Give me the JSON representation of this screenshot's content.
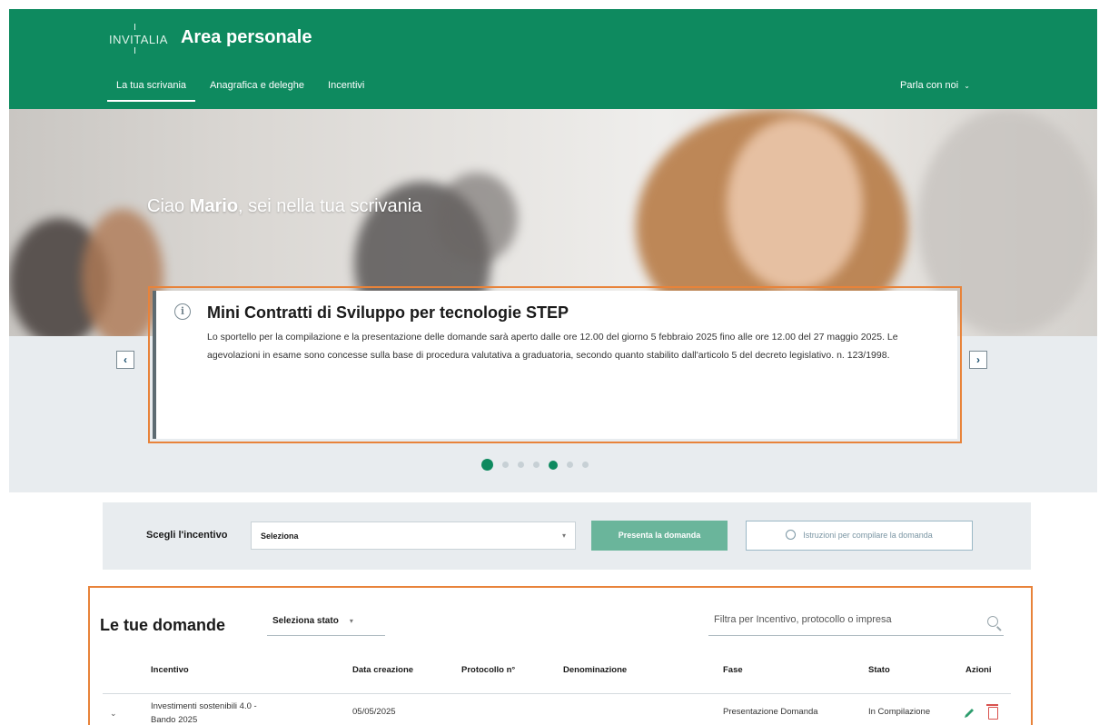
{
  "header": {
    "logo_text": "INVITALIA",
    "title": "Area personale",
    "nav": [
      "La tua scrivania",
      "Anagrafica e deleghe",
      "Incentivi"
    ],
    "contact": "Parla con noi",
    "brand_color": "#0e8a5f"
  },
  "hero": {
    "greeting_prefix": "Ciao ",
    "user_name": "Mario",
    "greeting_suffix": ", sei nella tua scrivania"
  },
  "announcement": {
    "title": "Mini Contratti di Sviluppo per tecnologie STEP",
    "body": "Lo sportello per la compilazione e la presentazione delle domande sarà aperto dalle ore 12.00 del giorno 5 febbraio 2025 fino alle ore 12.00 del 27 maggio 2025. Le agevolazioni in esame sono concesse sulla base di procedura valutativa a graduatoria, secondo quanto stabilito dall'articolo 5 del decreto legislativo. n. 123/1998."
  },
  "carousel": {
    "slides": 7,
    "active": 1
  },
  "incentive_bar": {
    "label": "Scegli l'incentivo",
    "select_value": "Seleziona",
    "submit_label": "Presenta la domanda",
    "instructions_label": "Istruzioni per compilare la domanda"
  },
  "domande": {
    "title": "Le tue domande",
    "status_select": "Seleziona stato",
    "filter_placeholder": "Filtra per Incentivo, protocollo o impresa",
    "columns": [
      "Incentivo",
      "Data creazione",
      "Protocollo n°",
      "Denominazione",
      "Fase",
      "Stato",
      "Azioni"
    ],
    "rows": [
      {
        "incentivo": "Investimenti sostenibili 4.0 - Bando 2025",
        "data": "05/05/2025",
        "protocollo": "",
        "denominazione": "",
        "fase": "Presentazione Domanda",
        "stato": "In Compilazione"
      }
    ]
  }
}
